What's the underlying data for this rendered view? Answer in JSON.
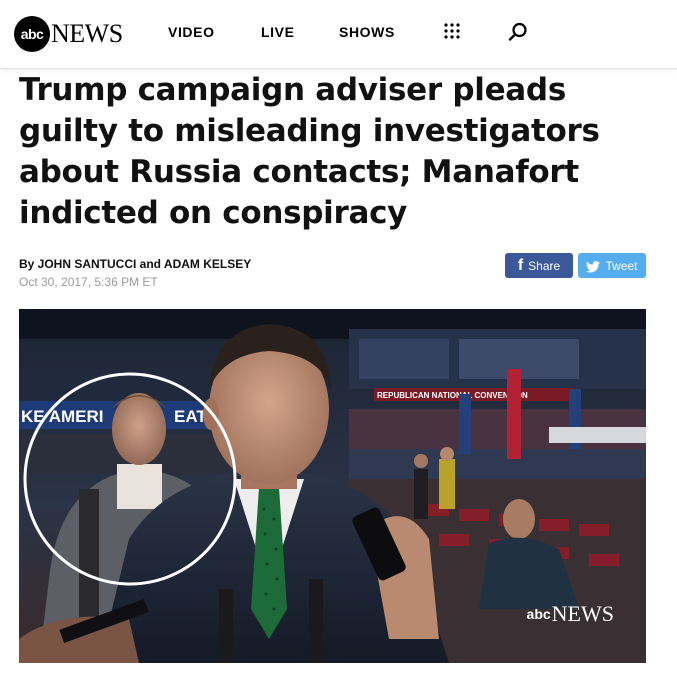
{
  "header": {
    "logo_circle": "abc",
    "logo_word": "NEWS",
    "nav": [
      {
        "label": "VIDEO"
      },
      {
        "label": "LIVE"
      },
      {
        "label": "SHOWS"
      }
    ],
    "menu_icon": "grid-icon",
    "search_icon": "search-icon"
  },
  "article": {
    "headline": "Trump campaign adviser pleads guilty to misleading investigators about Russia contacts; Manafort indicted on conspiracy",
    "byline": "By JOHN SANTUCCI and ADAM KELSEY",
    "timestamp": "Oct 30, 2017, 5:36 PM ET"
  },
  "share": {
    "facebook_label": "Share",
    "facebook_icon": "facebook-icon",
    "twitter_label": "Tweet",
    "twitter_icon": "twitter-icon"
  },
  "photo": {
    "banner_left": "KE AMERI",
    "banner_left_2": "EAT A",
    "banner_right": "REPUBLICAN NATIONAL CONVENTION",
    "watermark_circle": "abc",
    "watermark_word": "NEWS"
  },
  "colors": {
    "facebook": "#3b5998",
    "twitter": "#55acee",
    "timestamp": "#9a9a9a"
  }
}
